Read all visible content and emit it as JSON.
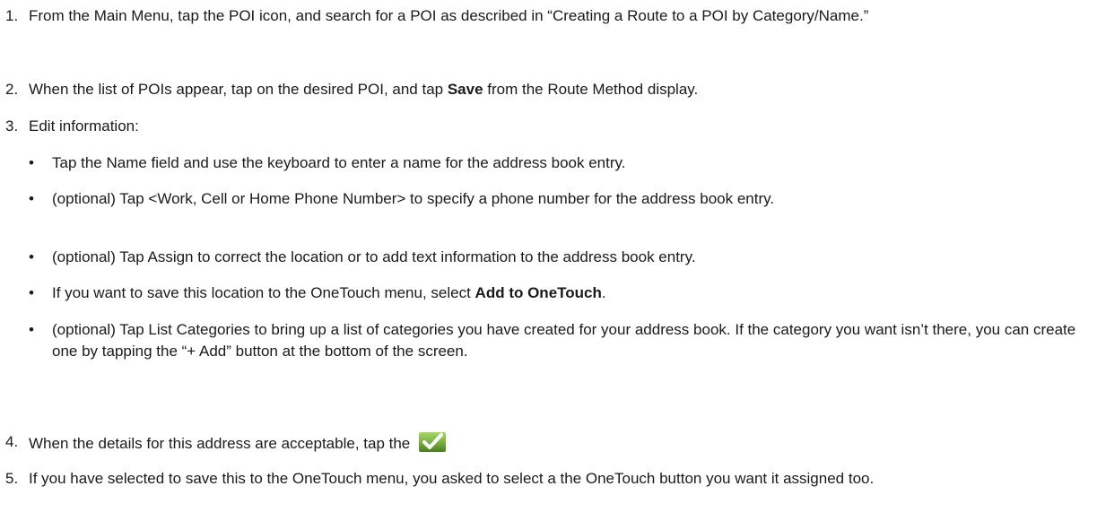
{
  "steps": [
    {
      "num": "1.",
      "text": "From the Main Menu, tap the POI icon, and search for a POI as described in “Creating a Route to a POI by Category/Name.”"
    },
    {
      "num": "2.",
      "pre": "When the list of POIs appear, tap on the desired POI, and tap ",
      "bold": "Save",
      "post": " from the Route Method display."
    },
    {
      "num": "3.",
      "text": "Edit information:"
    },
    {
      "num": "4.",
      "text": "When the details for this address are acceptable, tap the "
    },
    {
      "num": "5.",
      "text": "If you have selected to save this to the OneTouch menu, you asked to select a the OneTouch button you want it assigned too."
    }
  ],
  "bullets": [
    {
      "symbol": "•",
      "text": "Tap the Name field and use the keyboard to enter a name for the address book entry."
    },
    {
      "symbol": "•",
      "text": "(optional) Tap <Work, Cell or Home Phone Number> to specify a phone number for the address book entry."
    },
    {
      "symbol": "•",
      "text": "(optional) Tap Assign to correct the location or to add text information to the address book entry."
    },
    {
      "symbol": "•",
      "pre": "If you want to save this location to the OneTouch menu, select ",
      "bold": "Add to OneTouch",
      "post": "."
    },
    {
      "symbol": "•",
      "text": "(optional) Tap List Categories to bring up a list of categories you have created for your address book.  If the category you want isn’t there, you can create one by tapping the “+ Add” button at the bottom of the screen."
    }
  ],
  "icons": {
    "checkmark": "checkmark-button-icon",
    "checkmark_bg": "#7cb342",
    "checkmark_fg": "#ffffff"
  }
}
